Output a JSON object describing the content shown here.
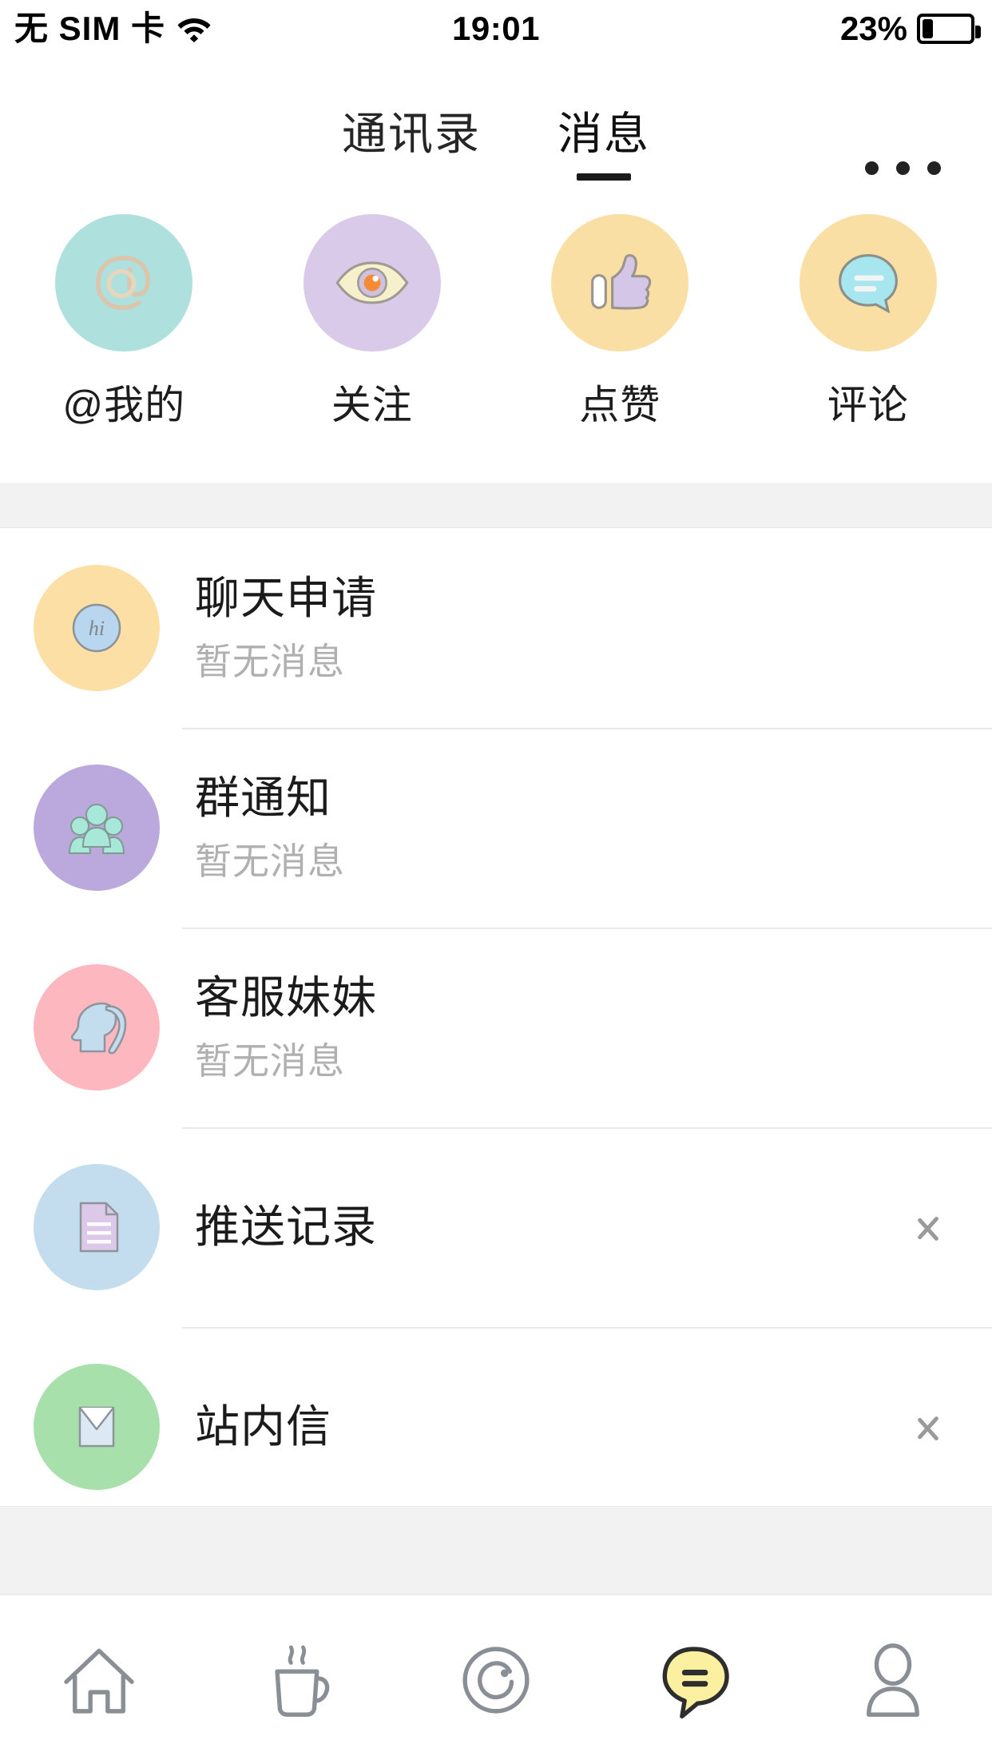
{
  "status_bar": {
    "carrier": "无 SIM 卡",
    "wifi_icon": "wifi-icon",
    "time": "19:01",
    "battery_percent": "23%",
    "battery_level": 23,
    "battery_icon": "battery-icon"
  },
  "header": {
    "tabs": [
      {
        "label": "通讯录",
        "name": "tab-contacts",
        "active": false
      },
      {
        "label": "消息",
        "name": "tab-messages",
        "active": true
      }
    ],
    "more_icon": "more-horizontal-icon"
  },
  "categories": [
    {
      "label": "@我的",
      "icon": "at-mention-icon",
      "circle_color": "#aee0dd",
      "glyph_color": "#d9c6ad"
    },
    {
      "label": "关注",
      "icon": "eye-icon",
      "circle_color": "#d8cae8",
      "glyph_color": "#f4efc8"
    },
    {
      "label": "点赞",
      "icon": "thumbs-up-icon",
      "circle_color": "#fadfa4",
      "glyph_color": "#cfc3e4"
    },
    {
      "label": "评论",
      "icon": "comment-bubble-icon",
      "circle_color": "#fadfa4",
      "glyph_color": "#a7e6ee"
    }
  ],
  "messages": [
    {
      "title": "聊天申请",
      "subtitle": "暂无消息",
      "icon": "hi-badge-icon",
      "avatar_color": "#fbdfa4",
      "inner_color": "#b8d6ee",
      "inner_text": "hi",
      "has_chevron": false
    },
    {
      "title": "群通知",
      "subtitle": "暂无消息",
      "icon": "group-people-icon",
      "avatar_color": "#bba8dc",
      "inner_color": "#a8e8d8",
      "has_chevron": false
    },
    {
      "title": "客服妹妹",
      "subtitle": "暂无消息",
      "icon": "female-head-icon",
      "avatar_color": "#fcb7bf",
      "inner_color": "#c3dcee",
      "has_chevron": false
    },
    {
      "title": "推送记录",
      "subtitle": "",
      "icon": "document-icon",
      "avatar_color": "#c3ddee",
      "inner_color": "#dcc8e8",
      "has_chevron": true
    },
    {
      "title": "站内信",
      "subtitle": "",
      "icon": "envelope-icon",
      "avatar_color": "#a8e0ab",
      "inner_color": "#dce9f5",
      "has_chevron": true
    }
  ],
  "bottom_nav": [
    {
      "icon": "home-icon",
      "active": false
    },
    {
      "icon": "coffee-cup-icon",
      "active": false
    },
    {
      "icon": "discover-circle-icon",
      "active": false
    },
    {
      "icon": "message-bubble-icon",
      "active": true
    },
    {
      "icon": "profile-person-icon",
      "active": false
    }
  ],
  "theme": {
    "accent_yellow": "#faf0a0",
    "icon_gray": "#8a8f96",
    "text_primary": "#1b1b1b",
    "text_muted": "#b0b0b0",
    "band_gray": "#f2f2f2"
  }
}
